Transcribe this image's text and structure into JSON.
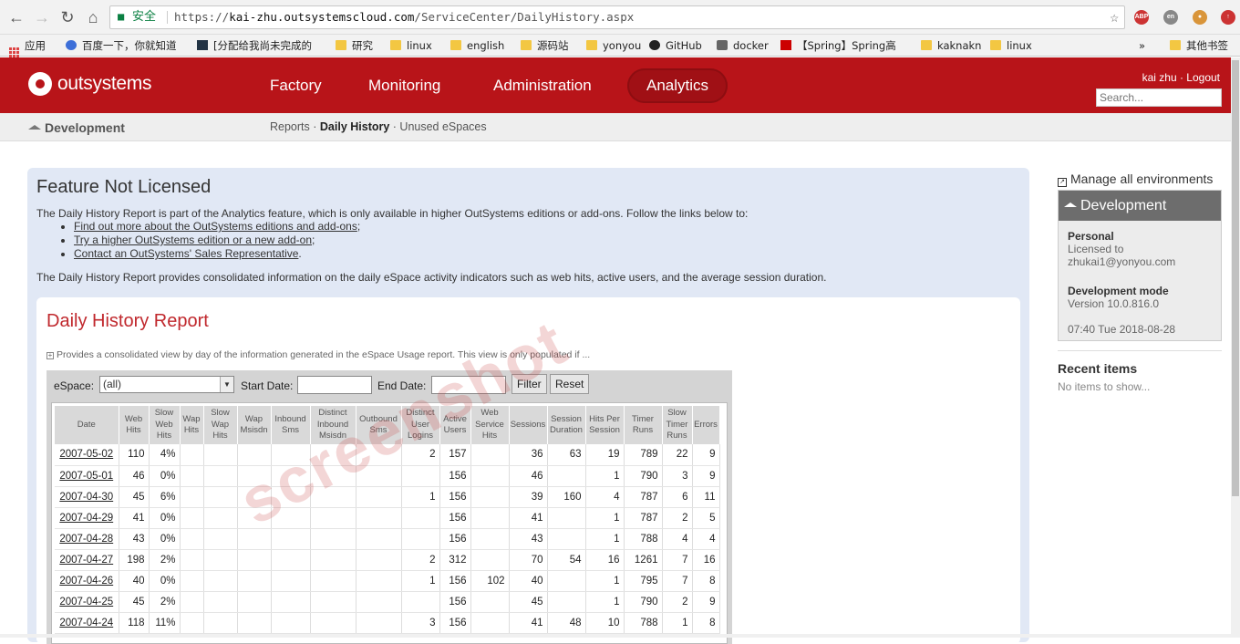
{
  "browser": {
    "secure_label": "安全",
    "url_prefix": "https://",
    "url_host": "kai-zhu.outsystemscloud.com",
    "url_path": "/ServiceCenter/DailyHistory.aspx",
    "bookmarks": [
      {
        "label": "应用"
      },
      {
        "label": "百度一下，你就知道"
      },
      {
        "label": "[分配给我尚未完成的"
      },
      {
        "label": "研究"
      },
      {
        "label": "linux"
      },
      {
        "label": "english"
      },
      {
        "label": "源码站"
      },
      {
        "label": "yonyou"
      },
      {
        "label": "GitHub"
      },
      {
        "label": "docker"
      },
      {
        "label": "【Spring】Spring高"
      },
      {
        "label": "kaknakn"
      },
      {
        "label": "linux"
      },
      {
        "label": "»"
      },
      {
        "label": "其他书签"
      }
    ]
  },
  "header": {
    "logo_text": "outsystems",
    "nav": [
      "Factory",
      "Monitoring",
      "Administration",
      "Analytics"
    ],
    "active_nav": "Analytics",
    "user": "kai zhu",
    "logout": "Logout",
    "search_placeholder": "Search..."
  },
  "subheader": {
    "title": "Development",
    "crumbs": [
      "Reports",
      "Daily History",
      "Unused eSpaces"
    ],
    "current": "Daily History"
  },
  "notice": {
    "title": "Feature Not Licensed",
    "intro": "The Daily History Report is part of the Analytics feature, which is only available in higher OutSystems editions or add-ons. Follow the links below to:",
    "links": [
      "Find out more about the OutSystems editions and add-ons",
      "Try a higher OutSystems edition or a new add-on",
      "Contact an OutSystems' Sales Representative"
    ],
    "outro": "The Daily History Report provides consolidated information on the daily eSpace activity indicators such as web hits, active users, and the average session duration."
  },
  "report": {
    "title": "Daily History Report",
    "provides": "Provides a consolidated view by day of the information generated in the eSpace Usage report. This view is only populated if ...",
    "espace_label": "eSpace:",
    "espace_value": "(all)",
    "start_label": "Start Date:",
    "end_label": "End Date:",
    "filter_btn": "Filter",
    "reset_btn": "Reset",
    "columns": [
      "Date",
      "Web Hits",
      "Slow Web Hits",
      "Wap Hits",
      "Slow Wap Hits",
      "Wap Msisdn",
      "Inbound Sms",
      "Distinct Inbound Msisdn",
      "Outbound Sms",
      "Distinct User Logins",
      "Active Users",
      "Web Service Hits",
      "Sessions",
      "Session Duration",
      "Hits Per Session",
      "Timer Runs",
      "Slow Timer Runs",
      "Errors"
    ],
    "rows": [
      [
        "2007-05-02",
        "110",
        "4%",
        "",
        "",
        "",
        "",
        "",
        "",
        "2",
        "157",
        "",
        "36",
        "63",
        "19",
        "789",
        "22",
        "9"
      ],
      [
        "2007-05-01",
        "46",
        "0%",
        "",
        "",
        "",
        "",
        "",
        "",
        "",
        "156",
        "",
        "46",
        "",
        "1",
        "790",
        "3",
        "9"
      ],
      [
        "2007-04-30",
        "45",
        "6%",
        "",
        "",
        "",
        "",
        "",
        "",
        "1",
        "156",
        "",
        "39",
        "160",
        "4",
        "787",
        "6",
        "11"
      ],
      [
        "2007-04-29",
        "41",
        "0%",
        "",
        "",
        "",
        "",
        "",
        "",
        "",
        "156",
        "",
        "41",
        "",
        "1",
        "787",
        "2",
        "5"
      ],
      [
        "2007-04-28",
        "43",
        "0%",
        "",
        "",
        "",
        "",
        "",
        "",
        "",
        "156",
        "",
        "43",
        "",
        "1",
        "788",
        "4",
        "4"
      ],
      [
        "2007-04-27",
        "198",
        "2%",
        "",
        "",
        "",
        "",
        "",
        "",
        "2",
        "312",
        "",
        "70",
        "54",
        "16",
        "1261",
        "7",
        "16"
      ],
      [
        "2007-04-26",
        "40",
        "0%",
        "",
        "",
        "",
        "",
        "",
        "",
        "1",
        "156",
        "102",
        "40",
        "",
        "1",
        "795",
        "7",
        "8"
      ],
      [
        "2007-04-25",
        "45",
        "2%",
        "",
        "",
        "",
        "",
        "",
        "",
        "",
        "156",
        "",
        "45",
        "",
        "1",
        "790",
        "2",
        "9"
      ],
      [
        "2007-04-24",
        "118",
        "11%",
        "",
        "",
        "",
        "",
        "",
        "",
        "3",
        "156",
        "",
        "41",
        "48",
        "10",
        "788",
        "1",
        "8"
      ]
    ],
    "watermark": "screenshot"
  },
  "sidebar": {
    "manage": "Manage all environments",
    "env_title": "Development",
    "personal": "Personal",
    "licensed_to": "Licensed to",
    "email": "zhukai1@yonyou.com",
    "mode_title": "Development mode",
    "version": "Version 10.0.816.0",
    "datetime": "07:40 Tue 2018-08-28",
    "recent_title": "Recent items",
    "no_items": "No items to show..."
  }
}
